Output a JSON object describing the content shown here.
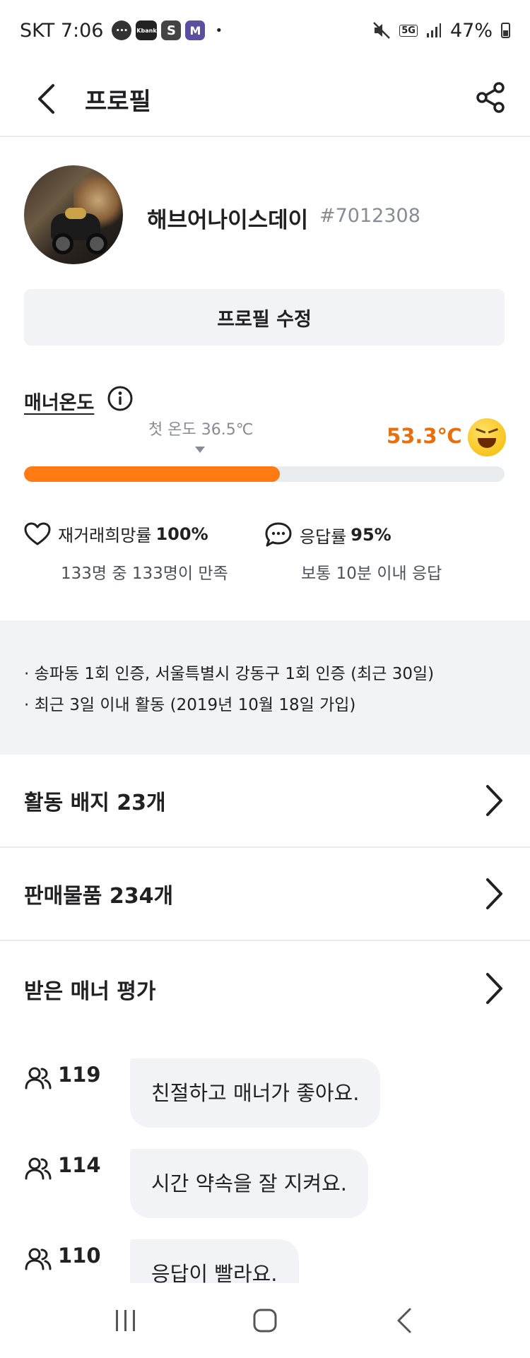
{
  "status_bar": {
    "carrier_time": "SKT 7:06",
    "kbank_label": "Kbank",
    "s_label": "S",
    "m_label": "M",
    "dot": "•",
    "network": "5G",
    "battery": "47%"
  },
  "header": {
    "title": "프로필"
  },
  "profile": {
    "nickname": "해브어나이스데이",
    "user_id": "#7012308",
    "edit_button": "프로필 수정"
  },
  "manner": {
    "label": "매너온도",
    "first_temp": "첫 온도 36.5℃",
    "temperature": "53.3℃",
    "bar_fill_percent": 53.3,
    "accent_color": "#ff7a13",
    "temp_text_color": "#e86f0c"
  },
  "stats": {
    "rebuy_label": "재거래희망률",
    "rebuy_value": "100%",
    "rebuy_sub": "133명 중 133명이 만족",
    "response_label": "응답률",
    "response_value": "95%",
    "response_sub": "보통 10분 이내 응답"
  },
  "info": {
    "line1": "· 송파동 1회 인증, 서울특별시 강동구 1회 인증 (최근 30일)",
    "line2": "· 최근 3일 이내 활동 (2019년 10월 18일 가입)"
  },
  "menu": {
    "badges": "활동 배지 23개",
    "products": "판매물품 234개",
    "manners": "받은 매너 평가"
  },
  "reviews": [
    {
      "count": "119",
      "text": "친절하고 매너가 좋아요."
    },
    {
      "count": "114",
      "text": "시간 약속을 잘 지켜요."
    },
    {
      "count": "110",
      "text": "응답이 빨라요."
    }
  ],
  "icons": {
    "back": "chevron-left-icon",
    "share": "share-icon",
    "info": "info-icon",
    "heart": "heart-icon",
    "chat": "chat-bubble-icon",
    "people": "people-icon"
  }
}
